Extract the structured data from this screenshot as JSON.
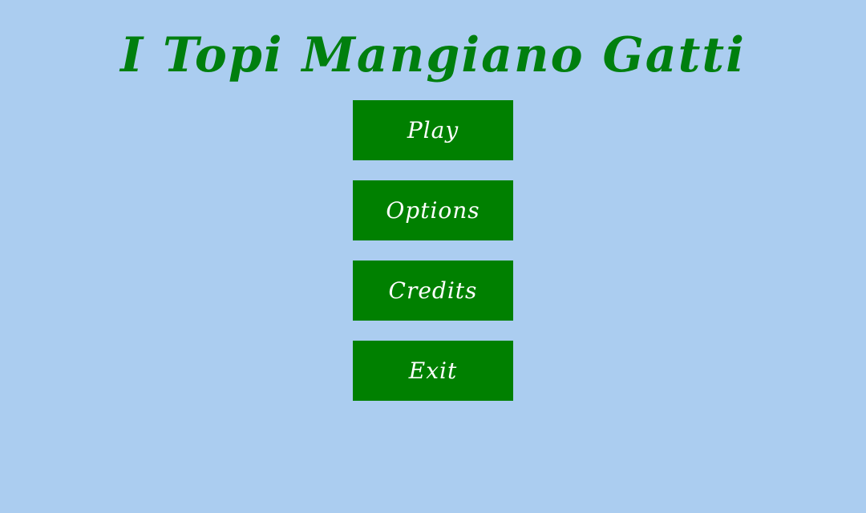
{
  "title": "I Topi Mangiano Gatti",
  "menu": {
    "play_label": "Play",
    "options_label": "Options",
    "credits_label": "Credits",
    "exit_label": "Exit"
  },
  "colors": {
    "background": "#abcdf0",
    "title": "#007f0e",
    "button": "#008000",
    "button_text": "#ffffff"
  }
}
